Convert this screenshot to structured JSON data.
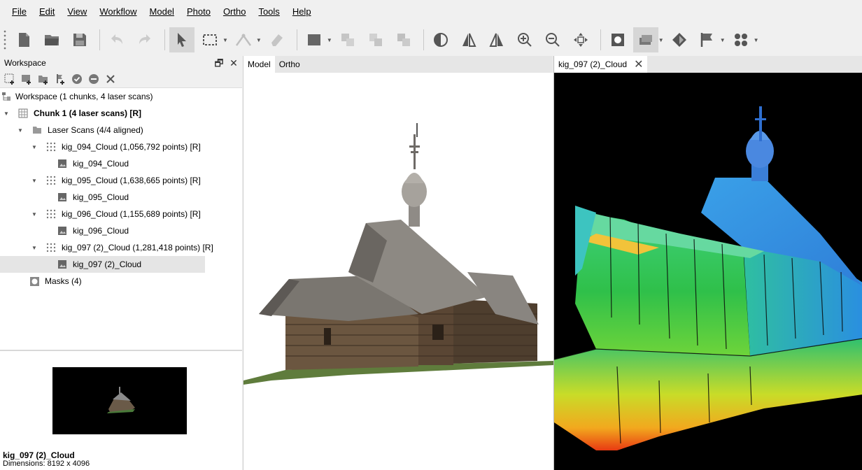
{
  "menu": [
    {
      "label": "File",
      "name": "menu-file"
    },
    {
      "label": "Edit",
      "name": "menu-edit"
    },
    {
      "label": "View",
      "name": "menu-view"
    },
    {
      "label": "Workflow",
      "name": "menu-workflow"
    },
    {
      "label": "Model",
      "name": "menu-model"
    },
    {
      "label": "Photo",
      "name": "menu-photo"
    },
    {
      "label": "Ortho",
      "name": "menu-ortho"
    },
    {
      "label": "Tools",
      "name": "menu-tools"
    },
    {
      "label": "Help",
      "name": "menu-help"
    }
  ],
  "toolbar": {
    "icons": [
      "new-document-icon",
      "open-folder-icon",
      "save-icon",
      "undo-icon",
      "redo-icon",
      "navigation-arrow-icon",
      "rectangle-selection-icon",
      "ruler-icon",
      "eraser-icon",
      "grid-icon",
      "crop-icon",
      "layers-icon",
      "duplicate-icon",
      "contrast-icon",
      "compare-icon",
      "flip-icon",
      "zoom-in-icon",
      "zoom-out-icon",
      "move-icon",
      "mask-icon",
      "view-mode-icon",
      "paint-icon",
      "flag-icon",
      "points-icon"
    ],
    "active": "navigation-arrow-icon"
  },
  "workspace": {
    "title": "Workspace",
    "tree": {
      "root": "Workspace (1 chunks, 4 laser scans)",
      "chunk": "Chunk 1 (4 laser scans) [R]",
      "laser_scans": "Laser Scans (4/4 aligned)",
      "scans": [
        {
          "cloud": "kig_094_Cloud (1,056,792 points) [R]",
          "image": "kig_094_Cloud"
        },
        {
          "cloud": "kig_095_Cloud (1,638,665 points) [R]",
          "image": "kig_095_Cloud"
        },
        {
          "cloud": "kig_096_Cloud (1,155,689 points) [R]",
          "image": "kig_096_Cloud"
        },
        {
          "cloud": "kig_097 (2)_Cloud (1,281,418 points) [R]",
          "image": "kig_097 (2)_Cloud"
        }
      ],
      "masks": "Masks (4)"
    },
    "selected": "kig_097 (2)_Cloud"
  },
  "preview": {
    "name": "kig_097 (2)_Cloud",
    "dimensions": "Dimensions: 8192 x 4096"
  },
  "tabs": {
    "model": "Model",
    "ortho": "Ortho",
    "cloud": "kig_097 (2)_Cloud"
  }
}
